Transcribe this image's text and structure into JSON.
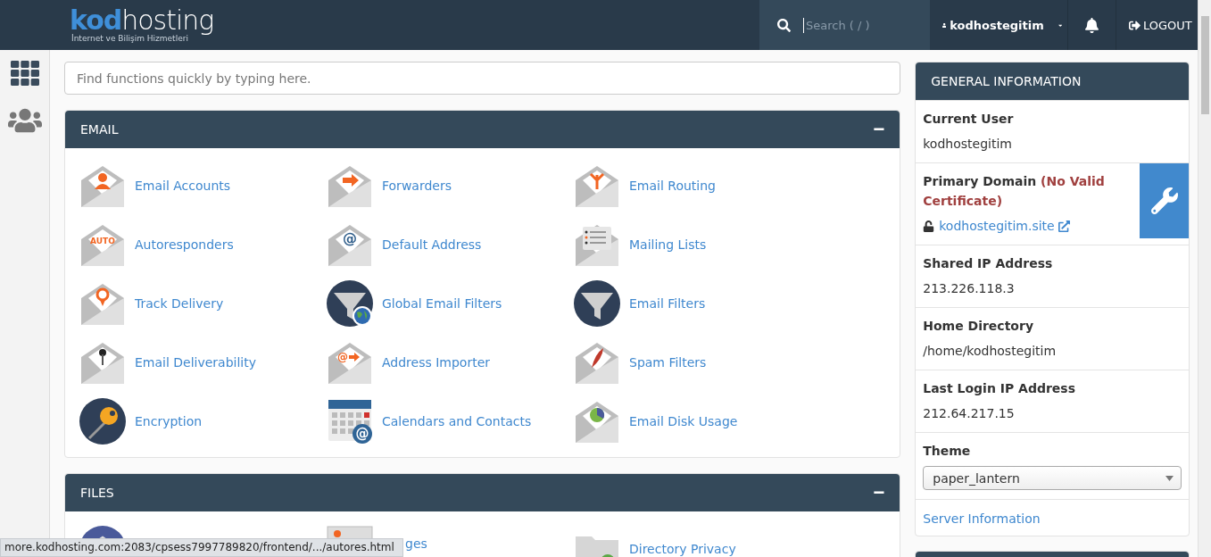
{
  "header": {
    "logo": {
      "bold": "kod",
      "light": "hosting",
      "tagline": "İnternet ve Bilişim Hizmetleri"
    },
    "search": {
      "placeholder": "Search ( / )"
    },
    "user": "kodhostegitim",
    "logout": "LOGOUT"
  },
  "function_search": {
    "placeholder": "Find functions quickly by typing here."
  },
  "sections": [
    {
      "title": "EMAIL",
      "collapse": "−",
      "items": [
        {
          "label": "Email Accounts",
          "kind": "person"
        },
        {
          "label": "Forwarders",
          "kind": "arrow"
        },
        {
          "label": "Email Routing",
          "kind": "routing"
        },
        {
          "label": "Autoresponders",
          "kind": "text",
          "icon_text": "AUTO"
        },
        {
          "label": "Default Address",
          "kind": "text",
          "icon_text": "@"
        },
        {
          "label": "Mailing Lists",
          "kind": "list"
        },
        {
          "label": "Track Delivery",
          "kind": "pin"
        },
        {
          "label": "Global Email Filters",
          "kind": "globe"
        },
        {
          "label": "Email Filters",
          "kind": "funnel"
        },
        {
          "label": "Email Deliverability",
          "kind": "key"
        },
        {
          "label": "Address Importer",
          "kind": "importer",
          "icon_text": "@"
        },
        {
          "label": "Spam Filters",
          "kind": "feather"
        },
        {
          "label": "Encryption",
          "kind": "encryption"
        },
        {
          "label": "Calendars and Contacts",
          "kind": "calendar",
          "icon_text": "@"
        },
        {
          "label": "Email Disk Usage",
          "kind": "pie"
        }
      ]
    },
    {
      "title": "FILES",
      "collapse": "−",
      "items": [
        {
          "kind": "disk"
        },
        {
          "label": "ges",
          "kind": "image"
        },
        {
          "label": "Directory Privacy",
          "kind": "folder"
        }
      ]
    }
  ],
  "general_information": {
    "title": "GENERAL INFORMATION",
    "rows": [
      {
        "kind": "text",
        "label": "Current User",
        "value": "kodhostegitim"
      },
      {
        "kind": "domain",
        "label": "Primary Domain",
        "warning": "(No Valid Certificate)",
        "value": "kodhostegitim.site"
      },
      {
        "kind": "text",
        "label": "Shared IP Address",
        "value": "213.226.118.3"
      },
      {
        "kind": "text",
        "label": "Home Directory",
        "value": "/home/kodhostegitim"
      },
      {
        "kind": "text",
        "label": "Last Login IP Address",
        "value": "212.64.217.15"
      },
      {
        "kind": "select",
        "label": "Theme",
        "value": "paper_lantern"
      },
      {
        "kind": "link",
        "value": "Server Information"
      }
    ]
  },
  "status_bar": "more.kodhosting.com:2083/cpsess7997789820/frontend/.../autores.html"
}
